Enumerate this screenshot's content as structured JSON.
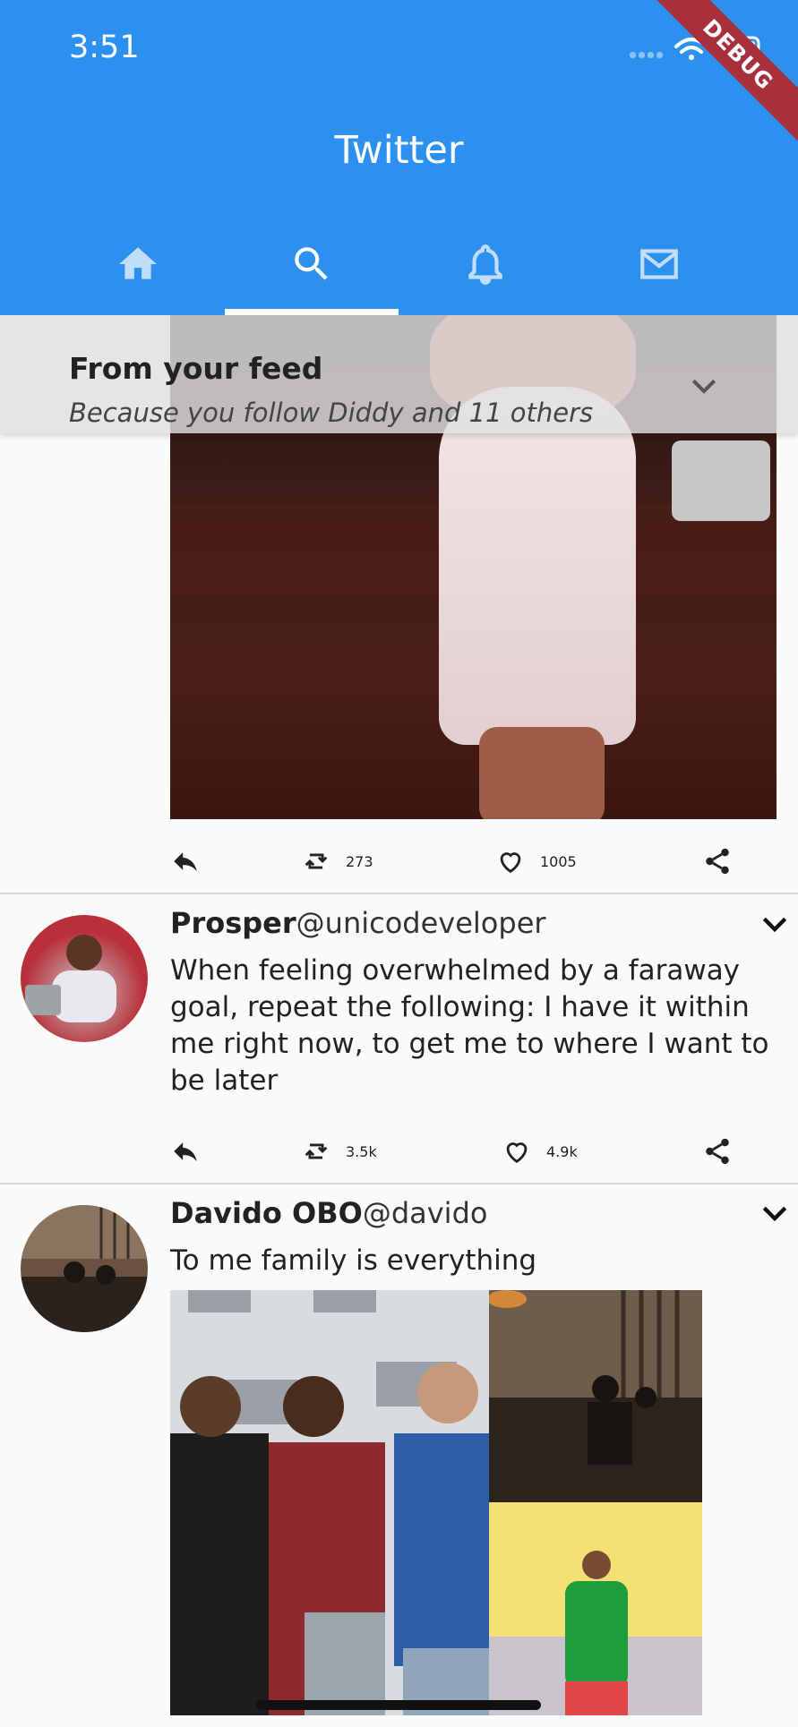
{
  "status_bar": {
    "time": "3:51"
  },
  "debug_label": "DEBUG",
  "app_bar": {
    "title": "Twitter",
    "tabs": [
      {
        "icon": "home-icon"
      },
      {
        "icon": "search-icon",
        "selected": true
      },
      {
        "icon": "bell-icon"
      },
      {
        "icon": "mail-icon"
      }
    ]
  },
  "feed_header": {
    "title": "From your feed",
    "subtitle": "Because you follow Diddy and 11 others"
  },
  "tweets": [
    {
      "retweets": "273",
      "likes": "1005"
    },
    {
      "name": "Prosper",
      "handle": "@unicodeveloper",
      "text": "When feeling overwhelmed by a faraway goal, repeat the following: I have it within me right now, to get me to where I want to be later",
      "retweets": "3.5k",
      "likes": "4.9k"
    },
    {
      "name": "Davido OBO",
      "handle": "@davido",
      "text": "To me family is everything"
    }
  ],
  "colors": {
    "primary": "#2c90ef",
    "ribbon": "#a8303d"
  }
}
